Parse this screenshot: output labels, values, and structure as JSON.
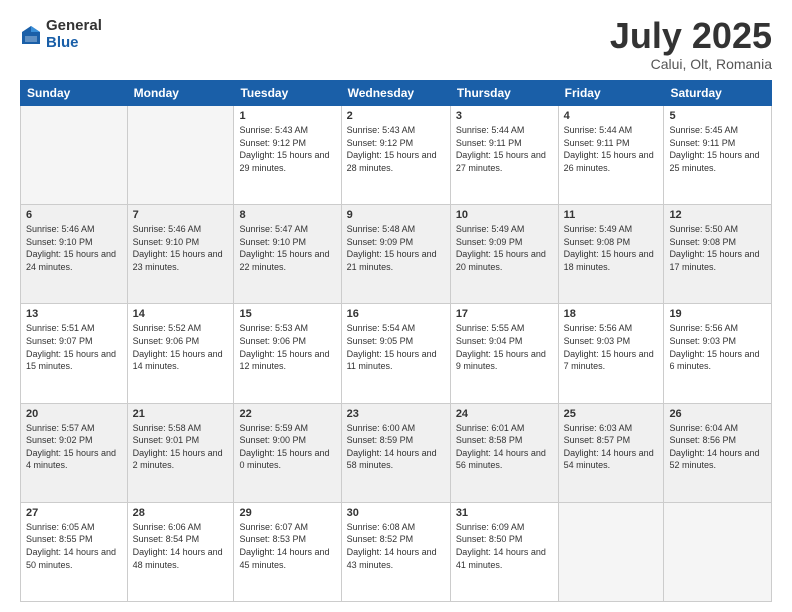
{
  "header": {
    "logo_general": "General",
    "logo_blue": "Blue",
    "month_title": "July 2025",
    "location": "Calui, Olt, Romania"
  },
  "days_of_week": [
    "Sunday",
    "Monday",
    "Tuesday",
    "Wednesday",
    "Thursday",
    "Friday",
    "Saturday"
  ],
  "weeks": [
    [
      {
        "num": "",
        "empty": true
      },
      {
        "num": "",
        "empty": true
      },
      {
        "num": "1",
        "sunrise": "5:43 AM",
        "sunset": "9:12 PM",
        "daylight": "15 hours and 29 minutes."
      },
      {
        "num": "2",
        "sunrise": "5:43 AM",
        "sunset": "9:12 PM",
        "daylight": "15 hours and 28 minutes."
      },
      {
        "num": "3",
        "sunrise": "5:44 AM",
        "sunset": "9:11 PM",
        "daylight": "15 hours and 27 minutes."
      },
      {
        "num": "4",
        "sunrise": "5:44 AM",
        "sunset": "9:11 PM",
        "daylight": "15 hours and 26 minutes."
      },
      {
        "num": "5",
        "sunrise": "5:45 AM",
        "sunset": "9:11 PM",
        "daylight": "15 hours and 25 minutes."
      }
    ],
    [
      {
        "num": "6",
        "sunrise": "5:46 AM",
        "sunset": "9:10 PM",
        "daylight": "15 hours and 24 minutes."
      },
      {
        "num": "7",
        "sunrise": "5:46 AM",
        "sunset": "9:10 PM",
        "daylight": "15 hours and 23 minutes."
      },
      {
        "num": "8",
        "sunrise": "5:47 AM",
        "sunset": "9:10 PM",
        "daylight": "15 hours and 22 minutes."
      },
      {
        "num": "9",
        "sunrise": "5:48 AM",
        "sunset": "9:09 PM",
        "daylight": "15 hours and 21 minutes."
      },
      {
        "num": "10",
        "sunrise": "5:49 AM",
        "sunset": "9:09 PM",
        "daylight": "15 hours and 20 minutes."
      },
      {
        "num": "11",
        "sunrise": "5:49 AM",
        "sunset": "9:08 PM",
        "daylight": "15 hours and 18 minutes."
      },
      {
        "num": "12",
        "sunrise": "5:50 AM",
        "sunset": "9:08 PM",
        "daylight": "15 hours and 17 minutes."
      }
    ],
    [
      {
        "num": "13",
        "sunrise": "5:51 AM",
        "sunset": "9:07 PM",
        "daylight": "15 hours and 15 minutes."
      },
      {
        "num": "14",
        "sunrise": "5:52 AM",
        "sunset": "9:06 PM",
        "daylight": "15 hours and 14 minutes."
      },
      {
        "num": "15",
        "sunrise": "5:53 AM",
        "sunset": "9:06 PM",
        "daylight": "15 hours and 12 minutes."
      },
      {
        "num": "16",
        "sunrise": "5:54 AM",
        "sunset": "9:05 PM",
        "daylight": "15 hours and 11 minutes."
      },
      {
        "num": "17",
        "sunrise": "5:55 AM",
        "sunset": "9:04 PM",
        "daylight": "15 hours and 9 minutes."
      },
      {
        "num": "18",
        "sunrise": "5:56 AM",
        "sunset": "9:03 PM",
        "daylight": "15 hours and 7 minutes."
      },
      {
        "num": "19",
        "sunrise": "5:56 AM",
        "sunset": "9:03 PM",
        "daylight": "15 hours and 6 minutes."
      }
    ],
    [
      {
        "num": "20",
        "sunrise": "5:57 AM",
        "sunset": "9:02 PM",
        "daylight": "15 hours and 4 minutes."
      },
      {
        "num": "21",
        "sunrise": "5:58 AM",
        "sunset": "9:01 PM",
        "daylight": "15 hours and 2 minutes."
      },
      {
        "num": "22",
        "sunrise": "5:59 AM",
        "sunset": "9:00 PM",
        "daylight": "15 hours and 0 minutes."
      },
      {
        "num": "23",
        "sunrise": "6:00 AM",
        "sunset": "8:59 PM",
        "daylight": "14 hours and 58 minutes."
      },
      {
        "num": "24",
        "sunrise": "6:01 AM",
        "sunset": "8:58 PM",
        "daylight": "14 hours and 56 minutes."
      },
      {
        "num": "25",
        "sunrise": "6:03 AM",
        "sunset": "8:57 PM",
        "daylight": "14 hours and 54 minutes."
      },
      {
        "num": "26",
        "sunrise": "6:04 AM",
        "sunset": "8:56 PM",
        "daylight": "14 hours and 52 minutes."
      }
    ],
    [
      {
        "num": "27",
        "sunrise": "6:05 AM",
        "sunset": "8:55 PM",
        "daylight": "14 hours and 50 minutes."
      },
      {
        "num": "28",
        "sunrise": "6:06 AM",
        "sunset": "8:54 PM",
        "daylight": "14 hours and 48 minutes."
      },
      {
        "num": "29",
        "sunrise": "6:07 AM",
        "sunset": "8:53 PM",
        "daylight": "14 hours and 45 minutes."
      },
      {
        "num": "30",
        "sunrise": "6:08 AM",
        "sunset": "8:52 PM",
        "daylight": "14 hours and 43 minutes."
      },
      {
        "num": "31",
        "sunrise": "6:09 AM",
        "sunset": "8:50 PM",
        "daylight": "14 hours and 41 minutes."
      },
      {
        "num": "",
        "empty": true
      },
      {
        "num": "",
        "empty": true
      }
    ]
  ]
}
